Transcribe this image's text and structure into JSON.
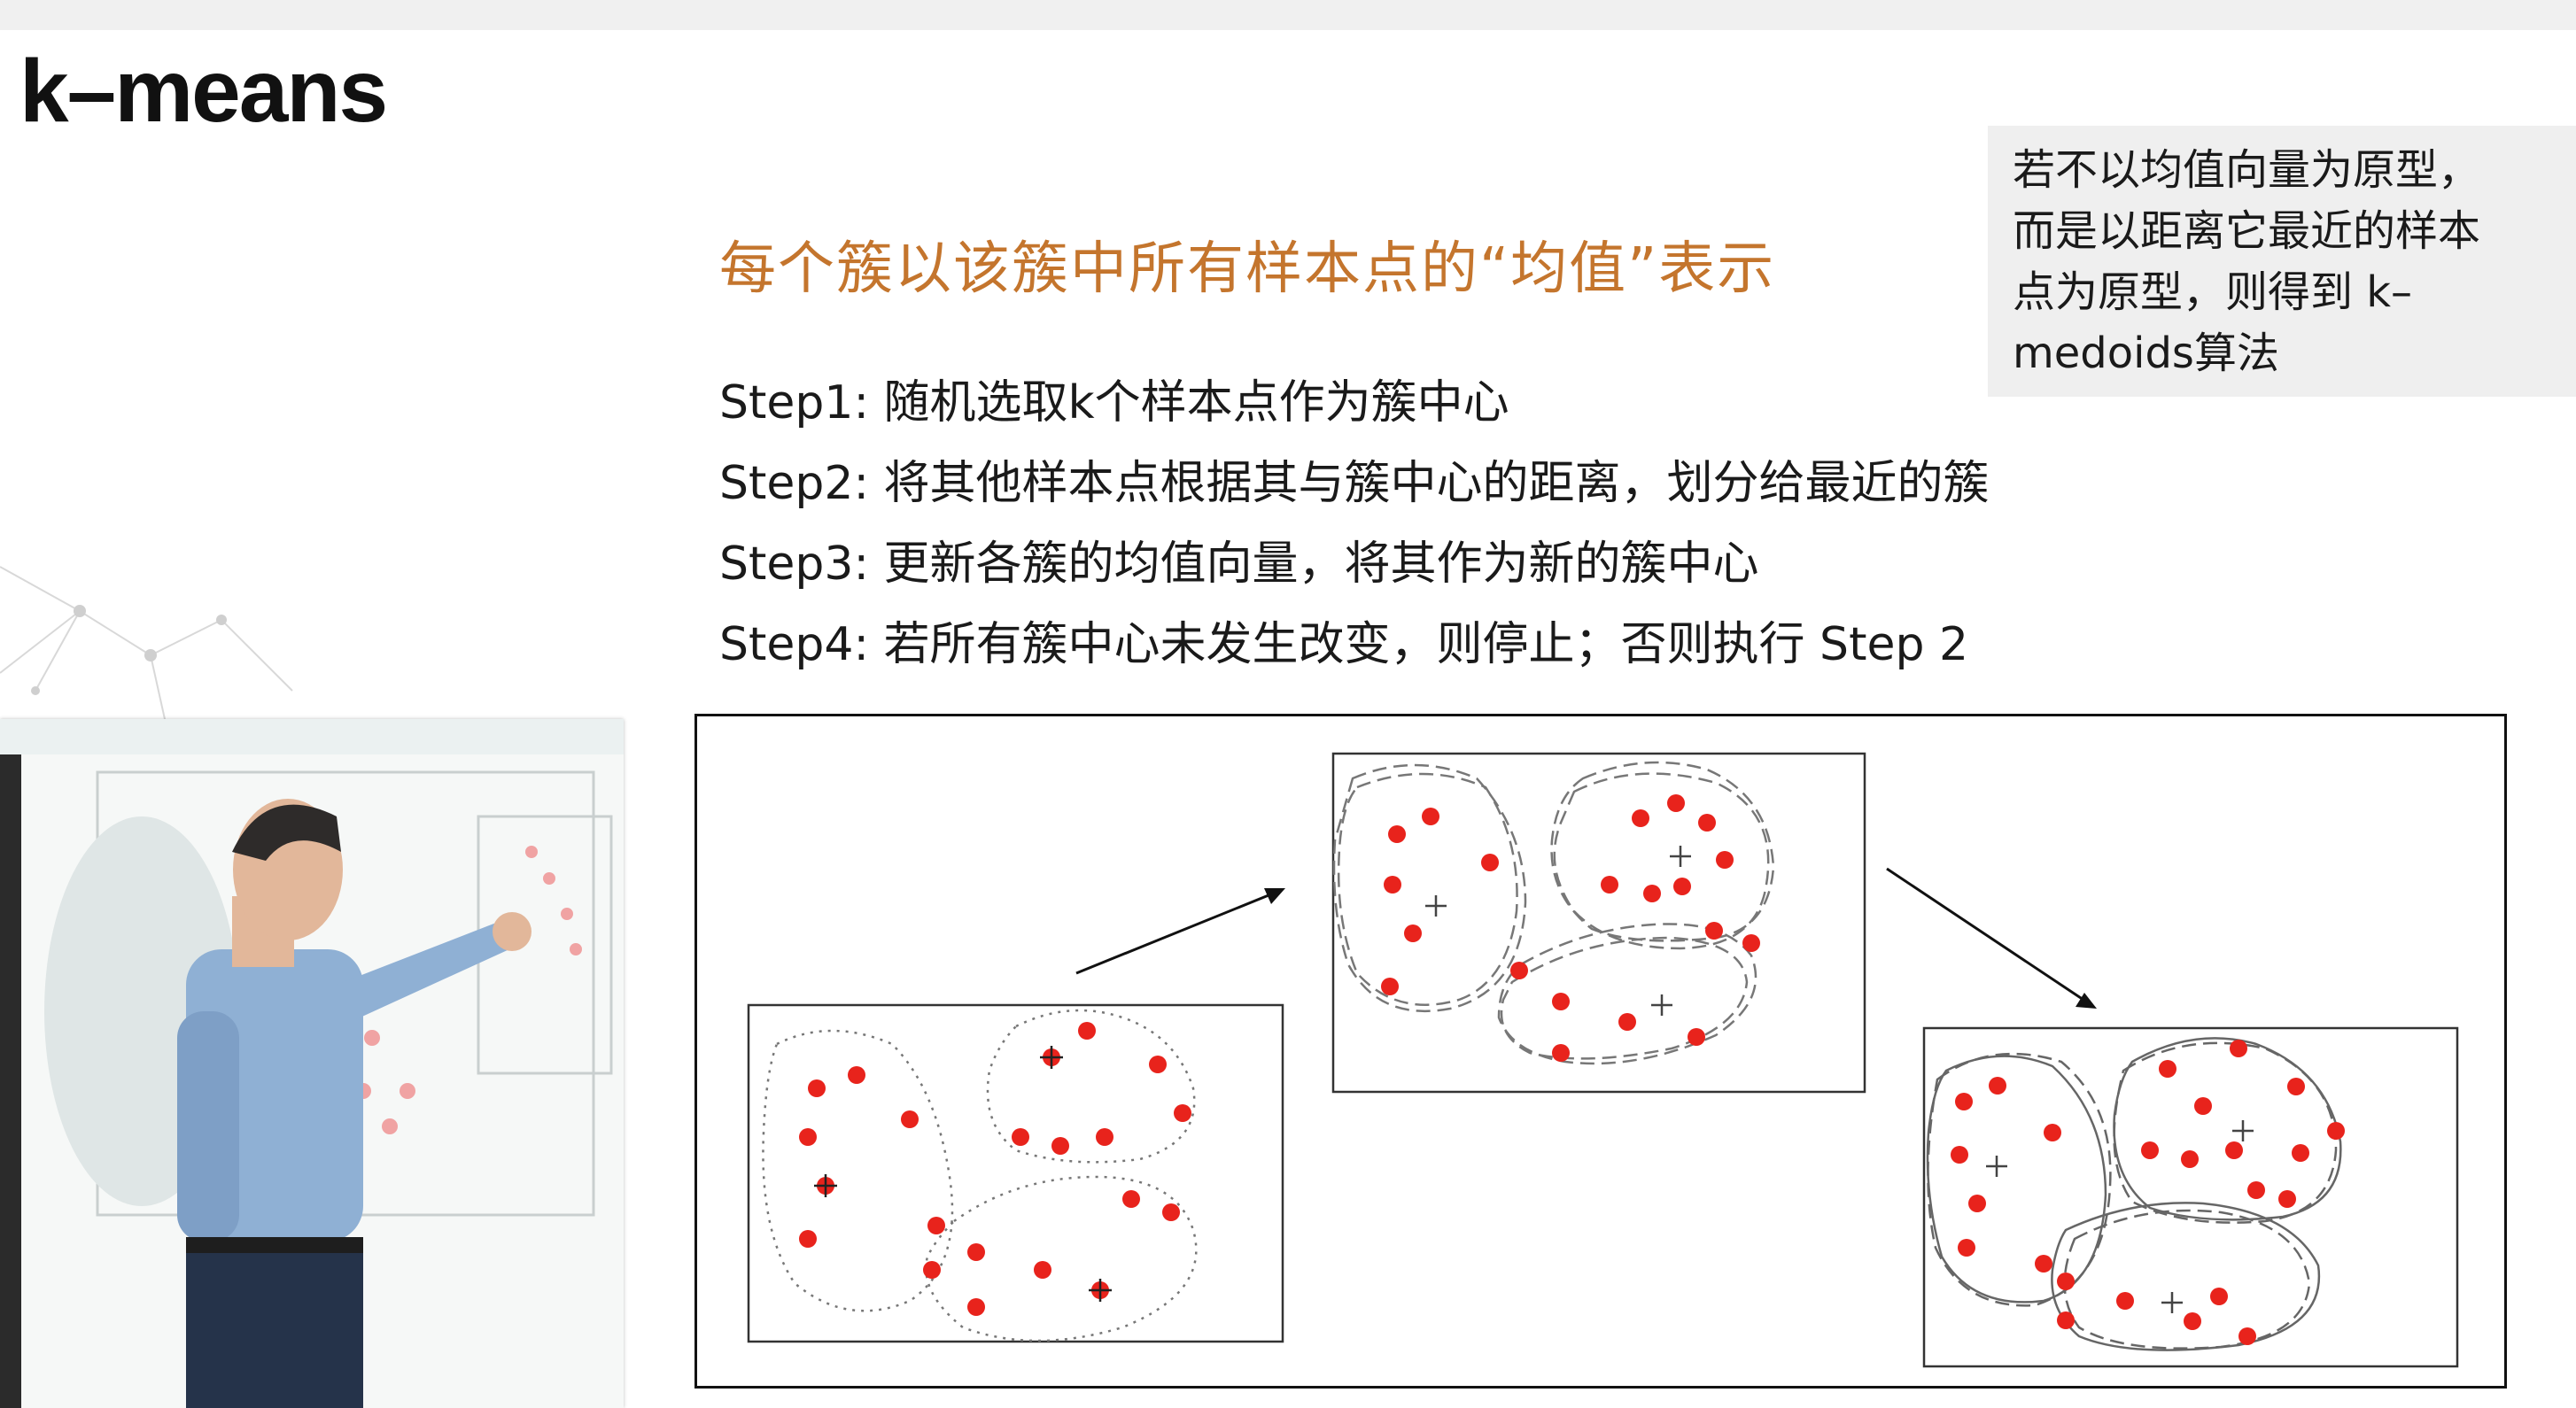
{
  "slide": {
    "title": "k–means",
    "subtitle": "每个簇以该簇中所有样本点的“均值”表示",
    "steps": [
      "Step1: 随机选取k个样本点作为簇中心",
      "Step2: 将其他样本点根据其与簇中心的距离，划分给最近的簇",
      "Step3: 更新各簇的均值向量，将其作为新的簇中心",
      "Step4: 若所有簇中心未发生改变，则停止；否则执行 Step 2"
    ],
    "note_lines": [
      "若不以均值向量为原型，",
      "而是以距离它最近的样本",
      "点为原型，则得到 k–",
      "medoids算法"
    ]
  },
  "colors": {
    "subtitle": "#c4752d",
    "point": "#e8231c",
    "note_bg": "#efefef",
    "accent_title": "#111111"
  },
  "icons": [
    "arrow-right-icon",
    "plus-center-icon"
  ]
}
